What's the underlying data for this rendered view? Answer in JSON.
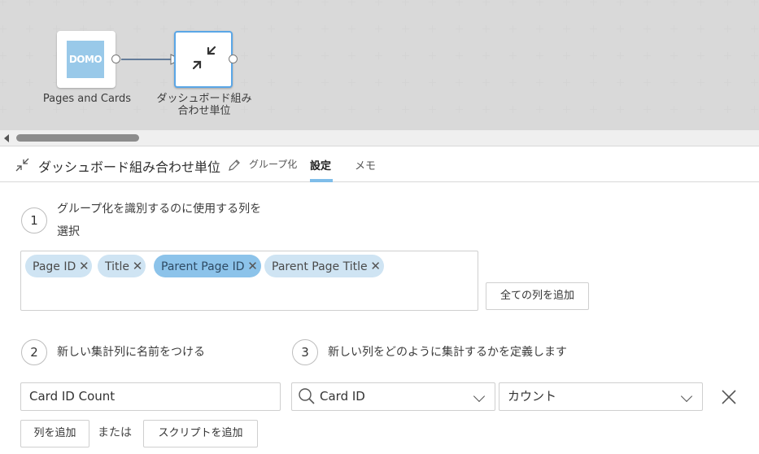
{
  "canvas": {
    "nodes": [
      {
        "label": "Pages and Cards",
        "logo_text": "DOMO"
      },
      {
        "label_line1": "ダッシュボード組み",
        "label_line2": "合わせ単位"
      }
    ]
  },
  "panel": {
    "title": "ダッシュボード組み合わせ単位",
    "tabs": [
      "グループ化",
      "設定",
      "メモ"
    ],
    "active_tab": "設定"
  },
  "step1": {
    "number": "1",
    "text_line1": "グループ化を識別するのに使用する列を",
    "text_line2": "選択",
    "chips": [
      "Page ID",
      "Title",
      "Parent Page ID",
      "Parent Page Title"
    ],
    "add_all_button": "全ての列を追加"
  },
  "step2": {
    "number": "2",
    "text": "新しい集計列に名前をつける",
    "name_value": "Card ID Count"
  },
  "step3": {
    "number": "3",
    "text": "新しい列をどのように集計するかを定義します",
    "column_value": "Card ID",
    "aggregation_value": "カウント"
  },
  "actions": {
    "add_column": "列を追加",
    "or": "または",
    "add_script": "スクリプトを追加"
  },
  "colors": {
    "accent": "#7fbde9",
    "chip": "#cfe4f3",
    "chip_selected": "#8cc3ea",
    "canvas_bg": "#efefef"
  }
}
